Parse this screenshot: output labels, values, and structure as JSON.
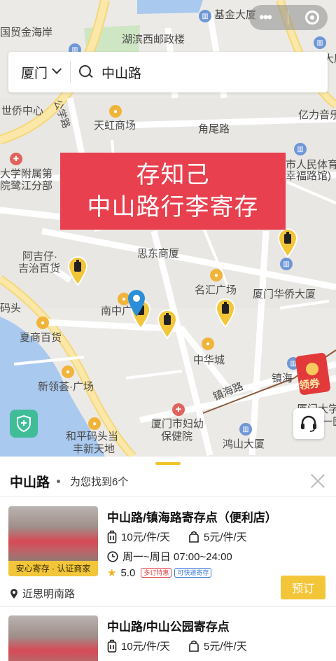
{
  "capsule": {
    "more": "•••"
  },
  "search": {
    "city": "厦门",
    "query": "中山路"
  },
  "banner": {
    "line1": "存知己",
    "line2": "中山路行李寄存"
  },
  "coupon": {
    "label": "领券"
  },
  "map_labels": [
    "国贸金海岸",
    "基金大厦",
    "湖滨西邮政楼",
    "世侨中心",
    "公学路",
    "天虹商场",
    "角尾路",
    "亿力音乐",
    "市人民体育",
    "幸福路馆)",
    "大学附属第",
    "院鹭江分部",
    "思东商厦",
    "阿吉仔·",
    "吉治百货",
    "名汇广场",
    "厦门华侨大厦",
    "码头",
    "南中广",
    "夏商百货",
    "中华城",
    "新领荟·广场",
    "镇海路",
    "镇海",
    "和平码头当",
    "丰新天地",
    "厦门市妇幼",
    "保健院",
    "鸿山大厦",
    "厦门大学",
    "一医",
    "大厦"
  ],
  "sheet": {
    "title": "中山路",
    "count_text": "为您找到6个"
  },
  "stores": [
    {
      "name": "中山路/镇海路寄存点（便利店）",
      "badge": "安心寄存 · 认证商家",
      "price_big": "10元/件/天",
      "price_small": "5元/件/天",
      "hours": "周一~周日 07:00~24:00",
      "rating": "5.0",
      "tags": [
        "多订特惠",
        "可快递寄存"
      ],
      "address": "近思明南路",
      "order_label": "预订"
    },
    {
      "name": "中山路/中山公园寄存点",
      "price_big": "10元/件/天",
      "price_small": "5元/件/天"
    }
  ],
  "colors": {
    "accent": "#f3c63a",
    "banner": "#e8404e",
    "shield": "#3ebd97"
  }
}
